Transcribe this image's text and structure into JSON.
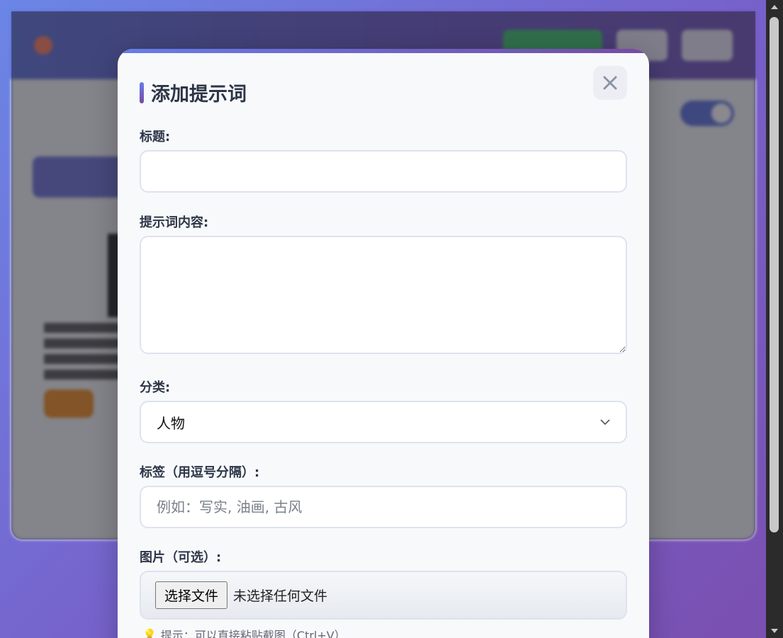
{
  "background": {
    "header_title": "",
    "section_title": "",
    "tab_label": ""
  },
  "modal": {
    "title": "添加提示词",
    "close_icon": "close-icon",
    "fields": {
      "title_label": "标题:",
      "title_value": "",
      "content_label": "提示词内容:",
      "content_value": "",
      "category_label": "分类:",
      "category_value": "人物",
      "tags_label": "标签（用逗号分隔）:",
      "tags_placeholder": "例如：写实, 油画, 古风",
      "image_label": "图片（可选）:",
      "file_button": "选择文件",
      "file_status": "未选择任何文件"
    },
    "hint": "提示：可以直接粘贴截图（Ctrl+V）"
  },
  "colors": {
    "accent_start": "#667eea",
    "accent_end": "#764ba2"
  }
}
